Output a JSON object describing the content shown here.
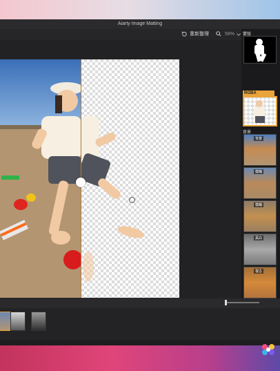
{
  "app": {
    "title": "Aiarty Image Matting"
  },
  "toolbar": {
    "undo_label": "重新整理",
    "zoom": "58%"
  },
  "side_panel": {
    "section_top": "蒙版",
    "rgba_badge": "RGBA",
    "section_filters": "背景",
    "filters": [
      "背景",
      "模糊",
      "模糊",
      "黑白",
      "復古"
    ]
  },
  "colors": {
    "accent": "#e9a43a",
    "window_bg": "#1e1e20"
  },
  "icons": [
    "undo-icon",
    "search-icon",
    "chevron-down-icon",
    "app-dock-icon"
  ]
}
